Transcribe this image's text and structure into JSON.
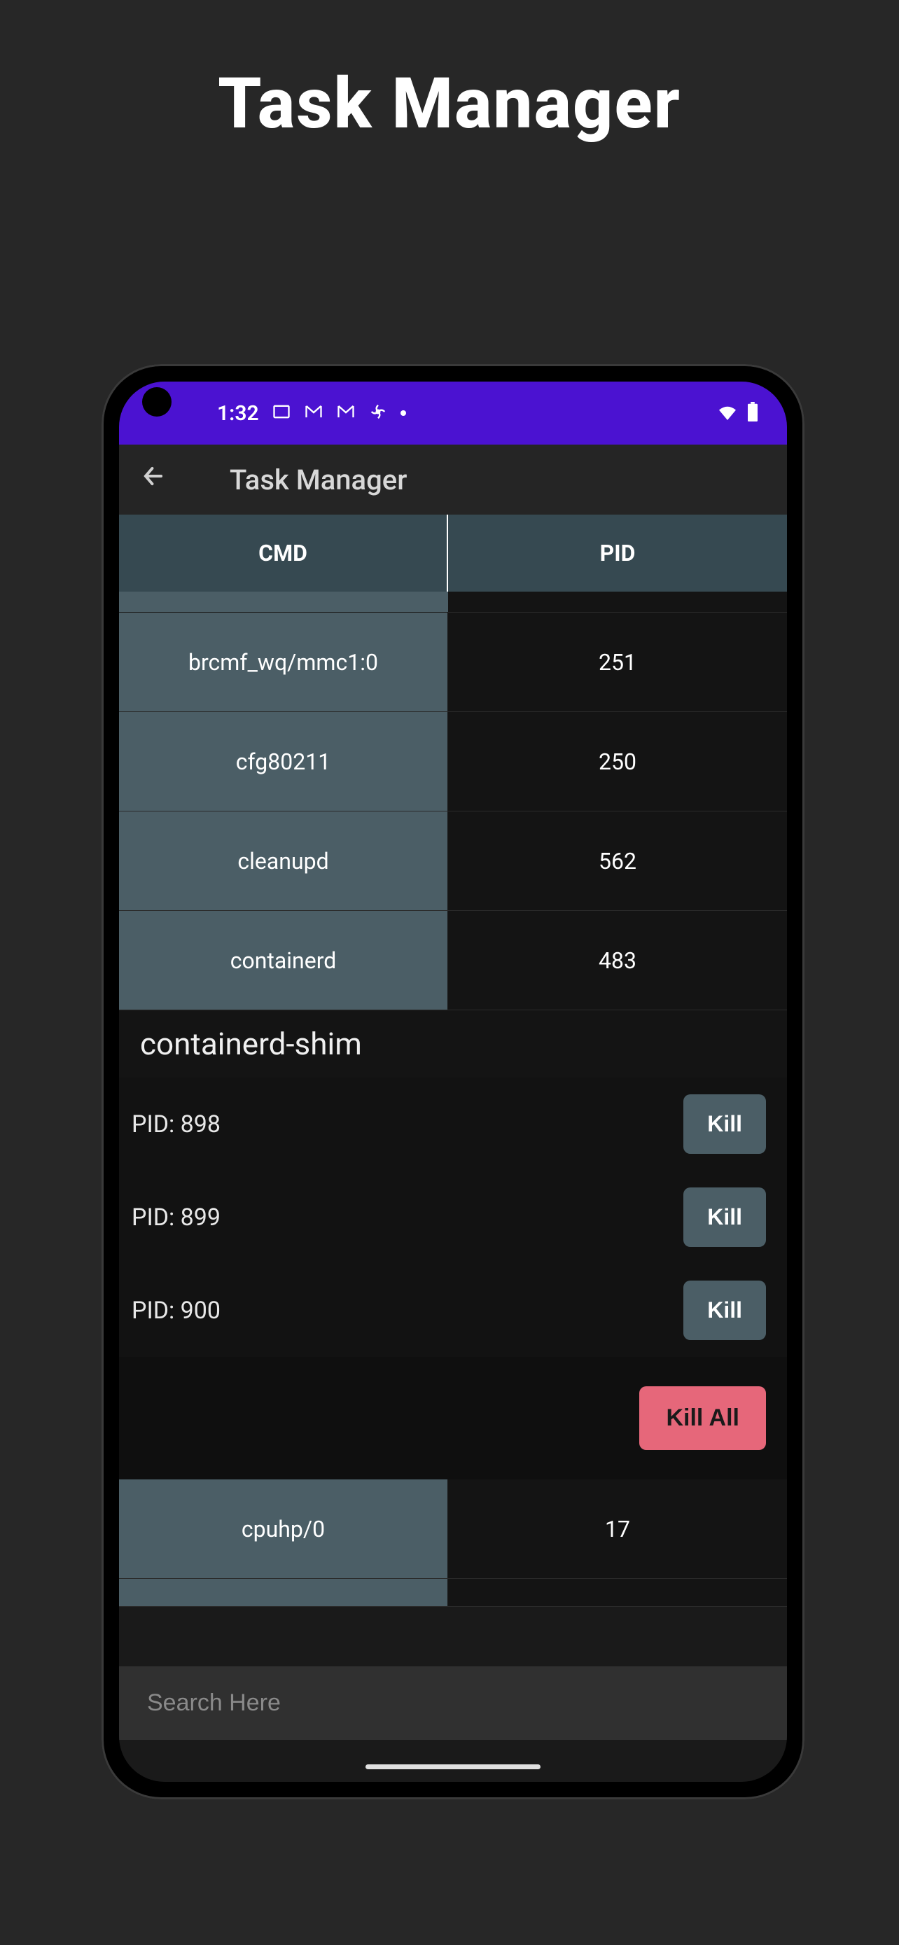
{
  "page": {
    "title": "Task Manager"
  },
  "statusbar": {
    "time": "1:32"
  },
  "appbar": {
    "title": "Task Manager"
  },
  "table": {
    "header_cmd": "CMD",
    "header_pid": "PID",
    "rows": [
      {
        "cmd": "brcmf_wq/mmc1:0",
        "pid": "251"
      },
      {
        "cmd": "cfg80211",
        "pid": "250"
      },
      {
        "cmd": "cleanupd",
        "pid": "562"
      },
      {
        "cmd": "containerd",
        "pid": "483"
      }
    ],
    "row_after": {
      "cmd": "cpuhp/0",
      "pid": "17"
    }
  },
  "expanded": {
    "name": "containerd-shim",
    "pids": [
      {
        "label": "PID: 898",
        "kill": "Kill"
      },
      {
        "label": "PID: 899",
        "kill": "Kill"
      },
      {
        "label": "PID: 900",
        "kill": "Kill"
      }
    ],
    "kill_all": "Kill All"
  },
  "search": {
    "placeholder": "Search Here"
  }
}
